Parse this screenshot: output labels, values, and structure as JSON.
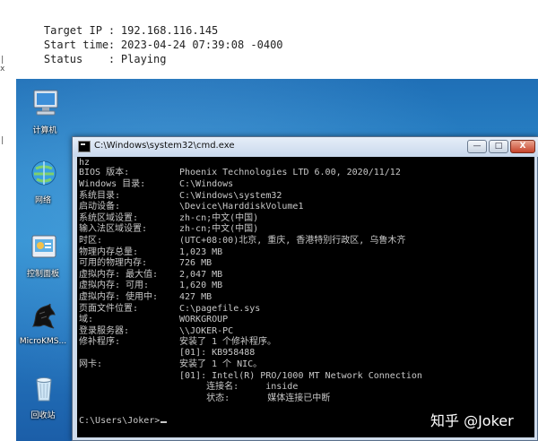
{
  "session": {
    "rows": [
      {
        "label": "Target IP",
        "value": "192.168.116.145"
      },
      {
        "label": "Start time",
        "value": "2023-04-24 07:39:08 -0400"
      },
      {
        "label": "Status",
        "value": "Playing"
      }
    ]
  },
  "desktop": {
    "icons": [
      {
        "label": "计算机",
        "icon": "computer-icon"
      },
      {
        "label": "网络",
        "icon": "network-icon"
      },
      {
        "label": "控制面板",
        "icon": "control-panel-icon"
      },
      {
        "label": "MicroKMS...",
        "icon": "dragon-icon"
      },
      {
        "label": "回收站",
        "icon": "recycle-bin-icon"
      }
    ]
  },
  "cmd": {
    "title": "C:\\Windows\\system32\\cmd.exe",
    "buttons": {
      "minimize": "—",
      "maximize": "□",
      "close": "X"
    },
    "lines": [
      {
        "key": "hz",
        "value": ""
      },
      {
        "key": "BIOS 版本:",
        "value": "Phoenix Technologies LTD 6.00, 2020/11/12"
      },
      {
        "key": "Windows 目录:",
        "value": "C:\\Windows"
      },
      {
        "key": "系统目录:",
        "value": "C:\\Windows\\system32"
      },
      {
        "key": "启动设备:",
        "value": "\\Device\\HarddiskVolume1"
      },
      {
        "key": "系统区域设置:",
        "value": "zh-cn;中文(中国)"
      },
      {
        "key": "输入法区域设置:",
        "value": "zh-cn;中文(中国)"
      },
      {
        "key": "时区:",
        "value": "(UTC+08:00)北京, 重庆, 香港特别行政区, 乌鲁木齐"
      },
      {
        "key": "物理内存总量:",
        "value": "1,023 MB"
      },
      {
        "key": "可用的物理内存:",
        "value": "726 MB"
      },
      {
        "key": "虚拟内存: 最大值:",
        "value": "2,047 MB"
      },
      {
        "key": "虚拟内存: 可用:",
        "value": "1,620 MB"
      },
      {
        "key": "虚拟内存: 使用中:",
        "value": "427 MB"
      },
      {
        "key": "页面文件位置:",
        "value": "C:\\pagefile.sys"
      },
      {
        "key": "域:",
        "value": "WORKGROUP"
      },
      {
        "key": "登录服务器:",
        "value": "\\\\JOKER-PC"
      },
      {
        "key": "修补程序:",
        "value": "安装了 1 个修补程序。"
      },
      {
        "key": "",
        "value": "[01]: KB958488"
      },
      {
        "key": "网卡:",
        "value": "安装了 1 个 NIC。"
      },
      {
        "key": "",
        "value": "[01]: Intel(R) PRO/1000 MT Network Connection"
      },
      {
        "key": "",
        "value": "     连接名:     inside"
      },
      {
        "key": "",
        "value": "     状态:       媒体连接已中断"
      }
    ],
    "prompt": "C:\\Users\\Joker>"
  },
  "watermark": "知乎 @Joker"
}
